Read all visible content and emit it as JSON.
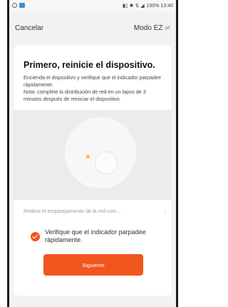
{
  "statusbar": {
    "right_text": "100% 13:40"
  },
  "topbar": {
    "cancel_label": "Cancelar",
    "mode_label": "Modo EZ",
    "mode_icon": "swap-icon"
  },
  "card": {
    "title": "Primero, reinicie el dispositivo.",
    "description": "Encienda el dispositivo y verifique que el indicador parpadee rápidamente.\nNota: complete la distribución de red en un lapso de 3 minutos después de reiniciar el dispositivo.",
    "link_text": "Realice el emparejamiento de la red com...",
    "confirm_label": "Verifique que el indicador parpadee rápidamente.",
    "button_label": "Siguiente"
  },
  "colors": {
    "accent": "#f1561e",
    "led": "#f0c419"
  }
}
